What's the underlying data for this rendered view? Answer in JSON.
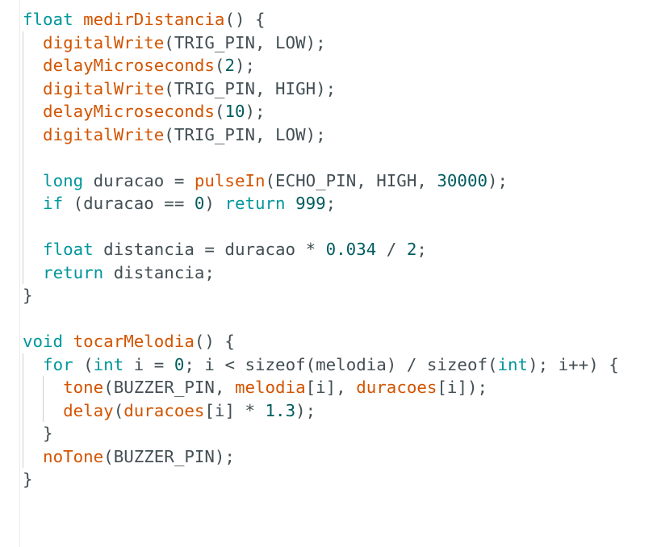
{
  "colors": {
    "keyword": "#00979c",
    "function": "#d35400",
    "number": "#005c5f",
    "plain": "#434f54",
    "background": "#ffffff"
  },
  "code": {
    "lines": [
      {
        "indent": 0,
        "tokens": [
          {
            "t": "float",
            "c": "kw"
          },
          {
            "t": " "
          },
          {
            "t": "medirDistancia",
            "c": "fn"
          },
          {
            "t": "() {"
          }
        ]
      },
      {
        "indent": 1,
        "tokens": [
          {
            "t": "digitalWrite",
            "c": "fn"
          },
          {
            "t": "(TRIG_PIN, LOW);"
          }
        ]
      },
      {
        "indent": 1,
        "tokens": [
          {
            "t": "delayMicroseconds",
            "c": "fn"
          },
          {
            "t": "("
          },
          {
            "t": "2",
            "c": "num"
          },
          {
            "t": ");"
          }
        ]
      },
      {
        "indent": 1,
        "tokens": [
          {
            "t": "digitalWrite",
            "c": "fn"
          },
          {
            "t": "(TRIG_PIN, HIGH);"
          }
        ]
      },
      {
        "indent": 1,
        "tokens": [
          {
            "t": "delayMicroseconds",
            "c": "fn"
          },
          {
            "t": "("
          },
          {
            "t": "10",
            "c": "num"
          },
          {
            "t": ");"
          }
        ]
      },
      {
        "indent": 1,
        "tokens": [
          {
            "t": "digitalWrite",
            "c": "fn"
          },
          {
            "t": "(TRIG_PIN, LOW);"
          }
        ]
      },
      {
        "indent": 1,
        "tokens": []
      },
      {
        "indent": 1,
        "tokens": [
          {
            "t": "long",
            "c": "kw"
          },
          {
            "t": " duracao = "
          },
          {
            "t": "pulseIn",
            "c": "fn"
          },
          {
            "t": "(ECHO_PIN, HIGH, "
          },
          {
            "t": "30000",
            "c": "num"
          },
          {
            "t": ");"
          }
        ]
      },
      {
        "indent": 1,
        "tokens": [
          {
            "t": "if",
            "c": "kw"
          },
          {
            "t": " (duracao == "
          },
          {
            "t": "0",
            "c": "num"
          },
          {
            "t": ") "
          },
          {
            "t": "return",
            "c": "kw"
          },
          {
            "t": " "
          },
          {
            "t": "999",
            "c": "num"
          },
          {
            "t": ";"
          }
        ]
      },
      {
        "indent": 1,
        "tokens": []
      },
      {
        "indent": 1,
        "tokens": [
          {
            "t": "float",
            "c": "kw"
          },
          {
            "t": " distancia = duracao * "
          },
          {
            "t": "0.034",
            "c": "num"
          },
          {
            "t": " / "
          },
          {
            "t": "2",
            "c": "num"
          },
          {
            "t": ";"
          }
        ]
      },
      {
        "indent": 1,
        "tokens": [
          {
            "t": "return",
            "c": "kw"
          },
          {
            "t": " distancia;"
          }
        ]
      },
      {
        "indent": 0,
        "tokens": [
          {
            "t": "}"
          }
        ]
      },
      {
        "indent": 0,
        "tokens": []
      },
      {
        "indent": 0,
        "tokens": [
          {
            "t": "void",
            "c": "kw"
          },
          {
            "t": " "
          },
          {
            "t": "tocarMelodia",
            "c": "fn"
          },
          {
            "t": "() {"
          }
        ]
      },
      {
        "indent": 1,
        "tokens": [
          {
            "t": "for",
            "c": "kw"
          },
          {
            "t": " ("
          },
          {
            "t": "int",
            "c": "kw"
          },
          {
            "t": " i = "
          },
          {
            "t": "0",
            "c": "num"
          },
          {
            "t": "; i < sizeof(melodia) / sizeof("
          },
          {
            "t": "int",
            "c": "kw"
          },
          {
            "t": "); i++) {"
          }
        ]
      },
      {
        "indent": 2,
        "tokens": [
          {
            "t": "tone",
            "c": "fn"
          },
          {
            "t": "(BUZZER_PIN, "
          },
          {
            "t": "melodia",
            "c": "fn"
          },
          {
            "t": "[i], "
          },
          {
            "t": "duracoes",
            "c": "fn"
          },
          {
            "t": "[i]);"
          }
        ]
      },
      {
        "indent": 2,
        "tokens": [
          {
            "t": "delay",
            "c": "fn"
          },
          {
            "t": "("
          },
          {
            "t": "duracoes",
            "c": "fn"
          },
          {
            "t": "[i] * "
          },
          {
            "t": "1.3",
            "c": "num"
          },
          {
            "t": ");"
          }
        ]
      },
      {
        "indent": 1,
        "tokens": [
          {
            "t": "}"
          }
        ]
      },
      {
        "indent": 1,
        "tokens": [
          {
            "t": "noTone",
            "c": "fn"
          },
          {
            "t": "(BUZZER_PIN);"
          }
        ]
      },
      {
        "indent": 0,
        "tokens": [
          {
            "t": "}"
          }
        ]
      }
    ]
  }
}
